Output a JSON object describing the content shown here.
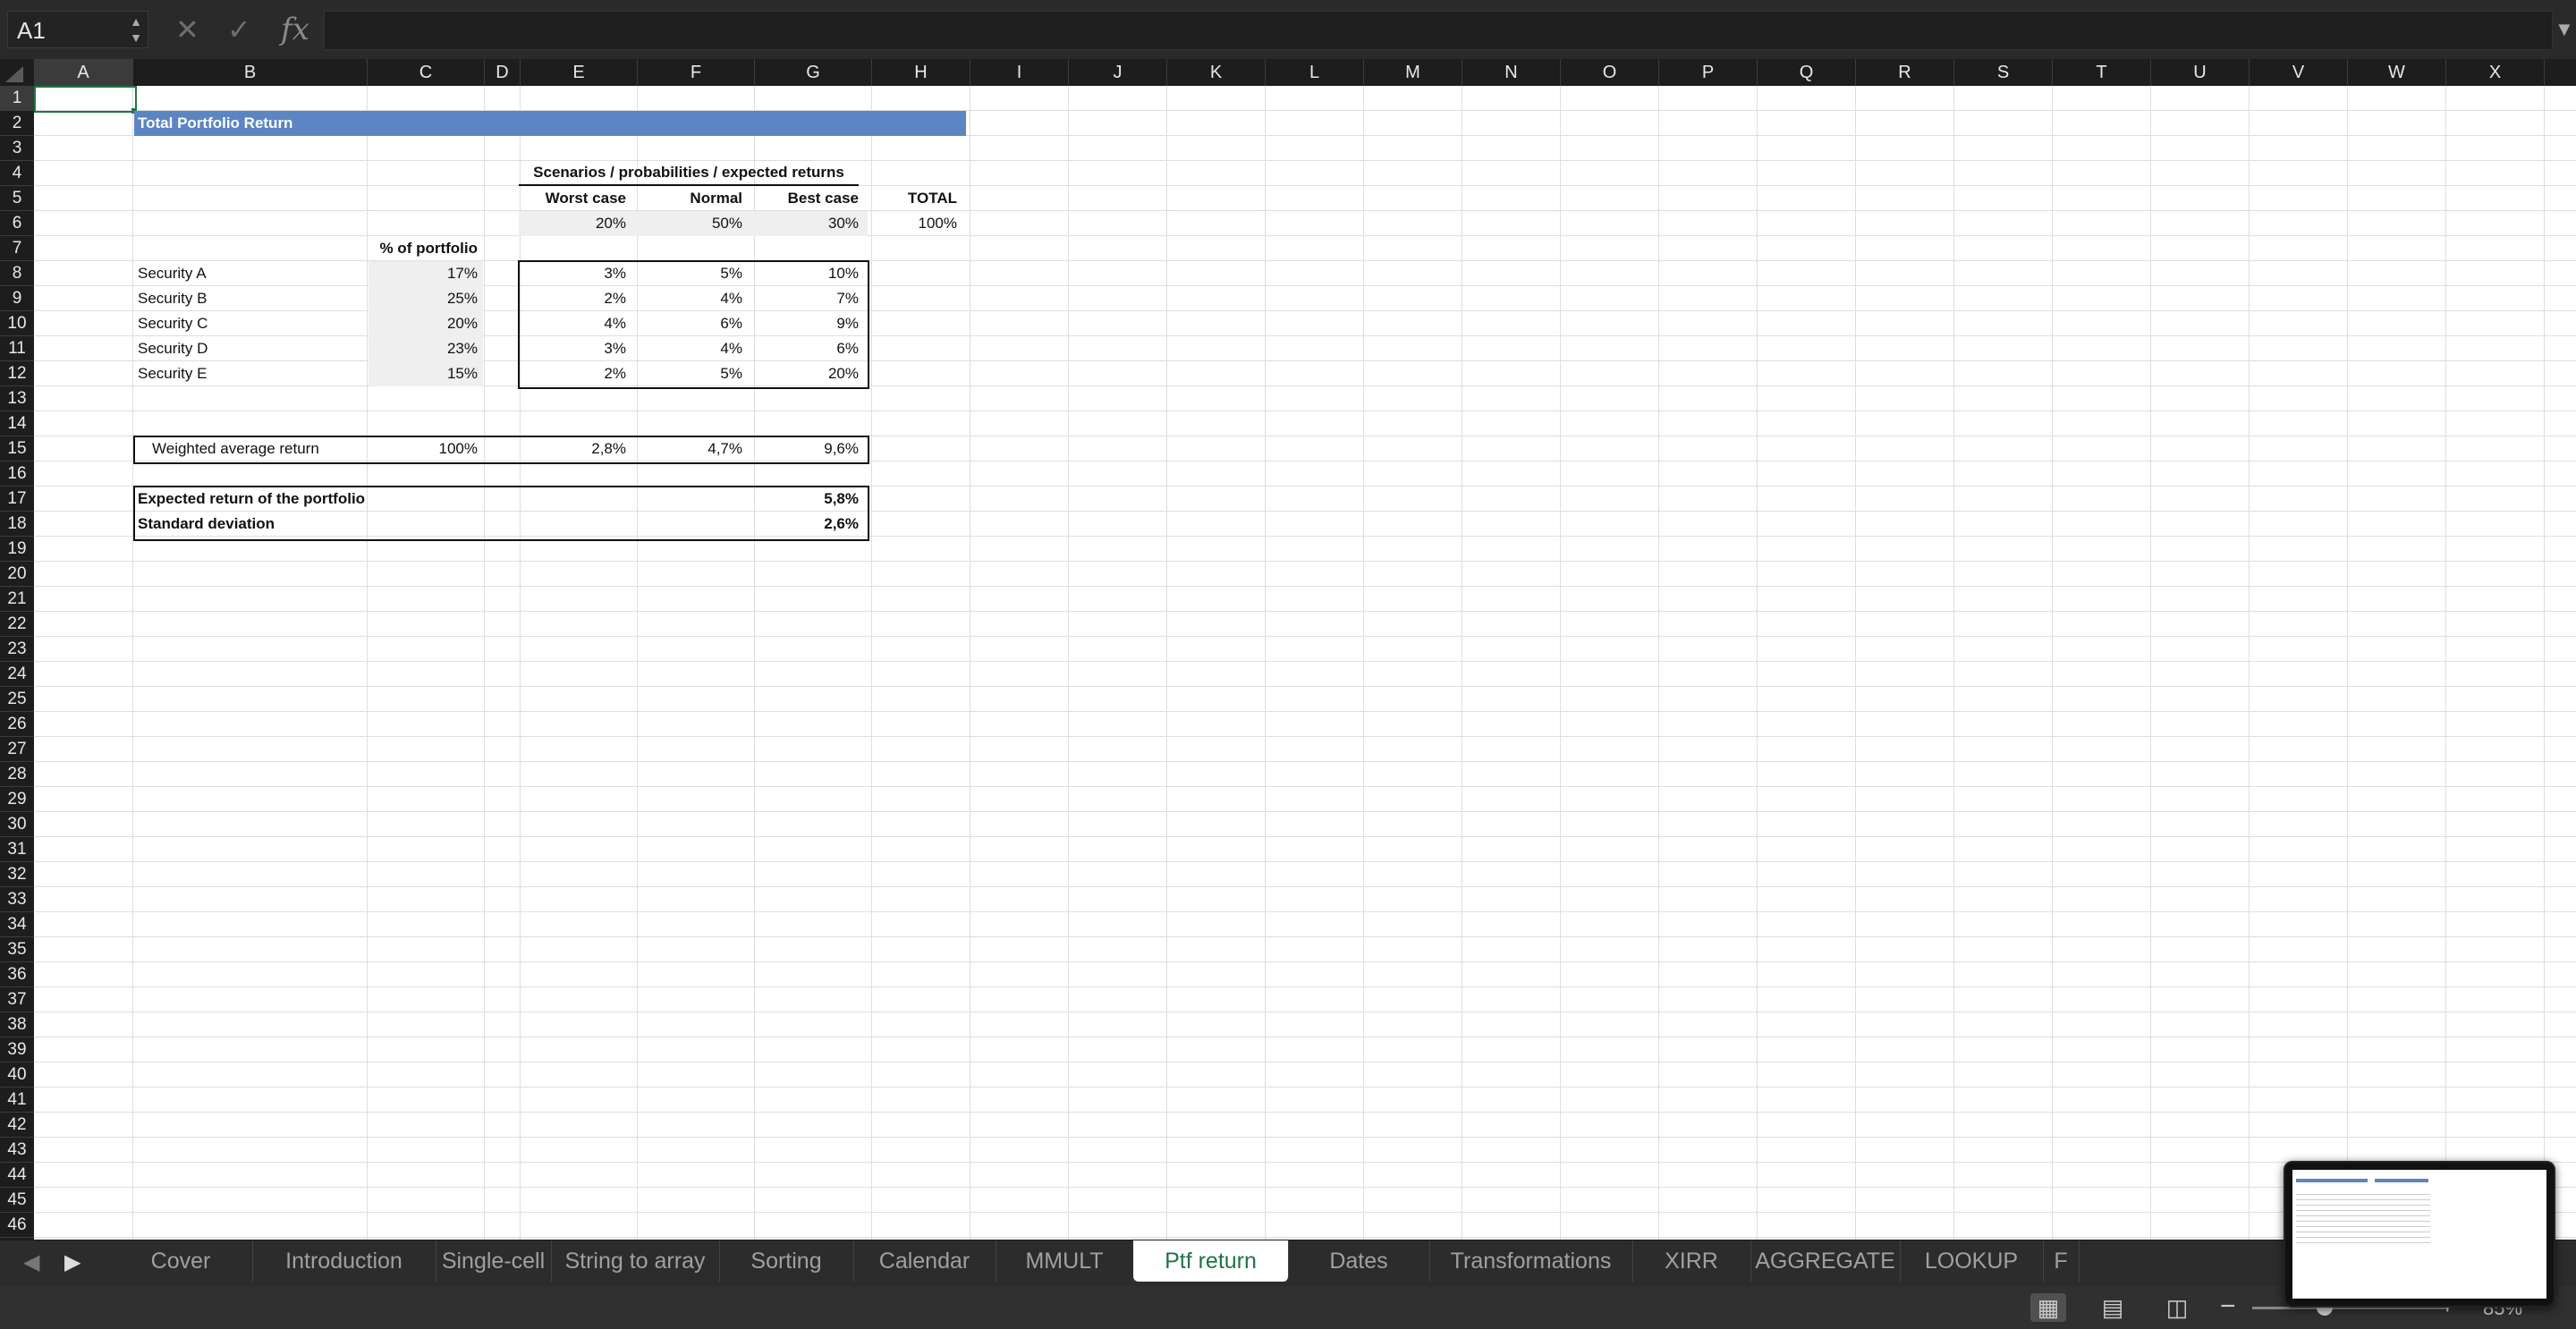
{
  "formula_bar": {
    "cell_ref": "A1",
    "formula": "",
    "fx_label": "fx"
  },
  "columns": [
    "A",
    "B",
    "C",
    "D",
    "E",
    "F",
    "G",
    "H",
    "I",
    "J",
    "K",
    "L",
    "M",
    "N",
    "O",
    "P",
    "Q",
    "R",
    "S",
    "T",
    "U",
    "V",
    "W",
    "X"
  ],
  "rows": [
    "1",
    "2",
    "3",
    "4",
    "5",
    "6",
    "7",
    "8",
    "9",
    "10",
    "11",
    "12",
    "13",
    "14",
    "15",
    "16",
    "17",
    "18",
    "19",
    "20",
    "21",
    "22",
    "23",
    "24",
    "25",
    "26",
    "27",
    "28",
    "29",
    "30",
    "31",
    "32",
    "33",
    "34",
    "35",
    "36",
    "37",
    "38",
    "39",
    "40",
    "41",
    "42",
    "43",
    "44",
    "45",
    "46"
  ],
  "sheet": {
    "title": "Total Portfolio Return",
    "scenarios_header": "Scenarios / probabilities / expected returns",
    "scenario_labels": [
      "Worst case",
      "Normal",
      "Best case"
    ],
    "total_label": "TOTAL",
    "probabilities": [
      "20%",
      "50%",
      "30%"
    ],
    "total_probability": "100%",
    "pct_header": "% of portfolio",
    "securities": [
      {
        "name": "Security A",
        "pct": "17%",
        "worst": "3%",
        "normal": "5%",
        "best": "10%"
      },
      {
        "name": "Security B",
        "pct": "25%",
        "worst": "2%",
        "normal": "4%",
        "best": "7%"
      },
      {
        "name": "Security C",
        "pct": "20%",
        "worst": "4%",
        "normal": "6%",
        "best": "9%"
      },
      {
        "name": "Security D",
        "pct": "23%",
        "worst": "3%",
        "normal": "4%",
        "best": "6%"
      },
      {
        "name": "Security E",
        "pct": "15%",
        "worst": "2%",
        "normal": "5%",
        "best": "20%"
      }
    ],
    "weighted_label": "Weighted average return",
    "weighted_pct": "100%",
    "weighted_worst": "2,8%",
    "weighted_normal": "4,7%",
    "weighted_best": "9,6%",
    "expected_label": "Expected return of the portfolio",
    "expected_value": "5,8%",
    "stdev_label": "Standard deviation",
    "stdev_value": "2,6%"
  },
  "tabs": [
    "Cover",
    "Introduction",
    "Single-cell",
    "String to array",
    "Sorting",
    "Calendar",
    "MMULT",
    "Ptf return",
    "Dates",
    "Transformations",
    "XIRR",
    "AGGREGATE",
    "LOOKUP",
    "F"
  ],
  "active_tab": "Ptf return",
  "zoom": "85%"
}
